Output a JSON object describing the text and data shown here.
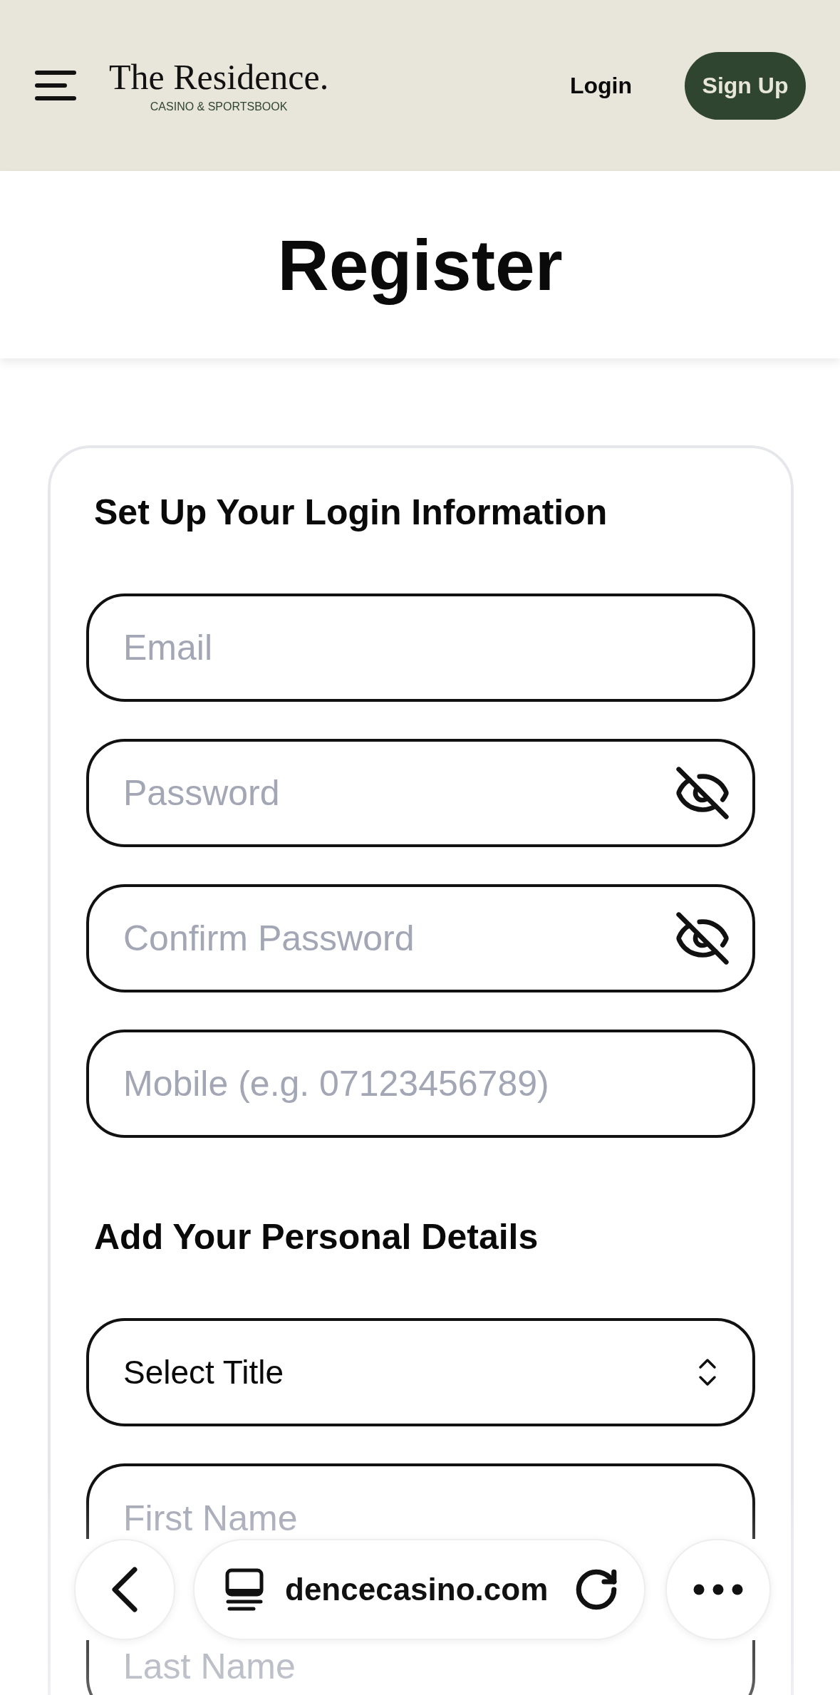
{
  "header": {
    "logo": {
      "title": "The Residence.",
      "tagline": "CASINO & SPORTSBOOK"
    },
    "actions": [
      {
        "kind": "link",
        "label": "Login"
      },
      {
        "kind": "button",
        "label": "Sign Up"
      }
    ]
  },
  "page_title": "Register",
  "sections": [
    {
      "heading": "Set Up Your Login Information",
      "fields": [
        {
          "kind": "text",
          "placeholder": "Email"
        },
        {
          "kind": "password",
          "placeholder": "Password"
        },
        {
          "kind": "password",
          "placeholder": "Confirm Password"
        },
        {
          "kind": "text",
          "placeholder": "Mobile (e.g. 07123456789)"
        }
      ]
    },
    {
      "heading": "Add Your Personal Details",
      "fields": [
        {
          "kind": "select",
          "value": "Select Title"
        },
        {
          "kind": "text",
          "placeholder": "First Name"
        },
        {
          "kind": "text",
          "placeholder": "Last Name"
        }
      ]
    }
  ],
  "browser_bar": {
    "url": "dencecasino.com"
  }
}
